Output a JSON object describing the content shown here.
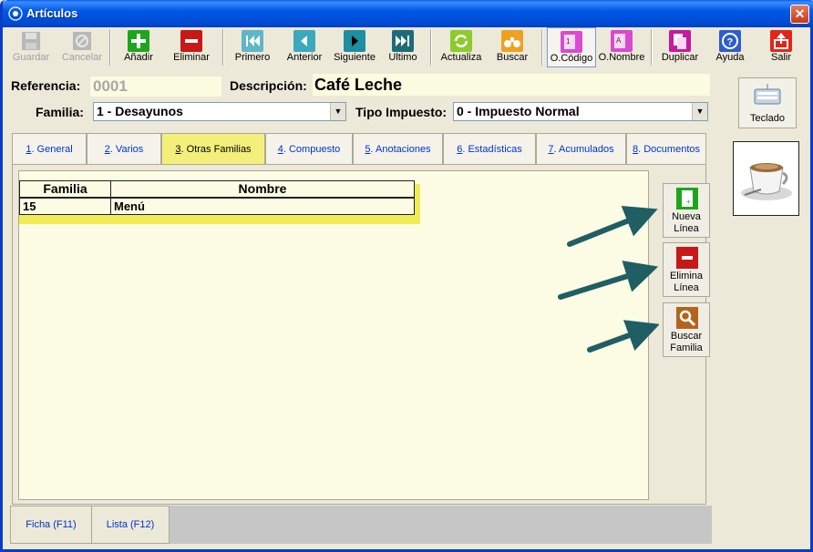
{
  "window": {
    "title": "Artículos",
    "close": "✕"
  },
  "toolbar": {
    "guardar": "Guardar",
    "cancelar": "Cancelar",
    "anadir": "Añadir",
    "eliminar": "Eliminar",
    "primero": "Primero",
    "anterior": "Anterior",
    "siguiente": "Siguiente",
    "ultimo": "Ultimo",
    "actualiza": "Actualiza",
    "buscar": "Buscar",
    "ocodigo": "O.Código",
    "onombre": "O.Nombre",
    "duplicar": "Duplicar",
    "ayuda": "Ayuda",
    "salir": "Salir"
  },
  "form": {
    "referencia_label": "Referencia:",
    "referencia_value": "0001",
    "descripcion_label": "Descripción:",
    "descripcion_value": "Café Leche",
    "familia_label": "Familia:",
    "familia_value": "1 - Desayunos",
    "impuesto_label": "Tipo Impuesto:",
    "impuesto_value": "0 - Impuesto Normal"
  },
  "tabs": [
    {
      "num": "1",
      "label": ". General"
    },
    {
      "num": "2",
      "label": ". Varios"
    },
    {
      "num": "3",
      "label": ". Otras Familias"
    },
    {
      "num": "4",
      "label": ". Compuesto"
    },
    {
      "num": "5",
      "label": ". Anotaciones"
    },
    {
      "num": "6",
      "label": ". Estadísticas"
    },
    {
      "num": "7",
      "label": ". Acumulados"
    },
    {
      "num": "8",
      "label": ". Documentos"
    }
  ],
  "grid": {
    "columns": [
      "Familia",
      "Nombre"
    ],
    "rows": [
      {
        "familia": "15",
        "nombre": "Menú"
      }
    ]
  },
  "side_buttons": {
    "nueva_1": "Nueva",
    "nueva_2": "Línea",
    "elimina_1": "Elimina",
    "elimina_2": "Línea",
    "buscar_1": "Buscar",
    "buscar_2": "Familia"
  },
  "right": {
    "teclado": "Teclado"
  },
  "bottom_tabs": {
    "ficha": "Ficha (F11)",
    "lista": "Lista (F12)"
  },
  "colors": {
    "accent_yellow": "#F2F07A",
    "grid_bg": "#FCFCE4",
    "arrow": "#1F5E63"
  }
}
